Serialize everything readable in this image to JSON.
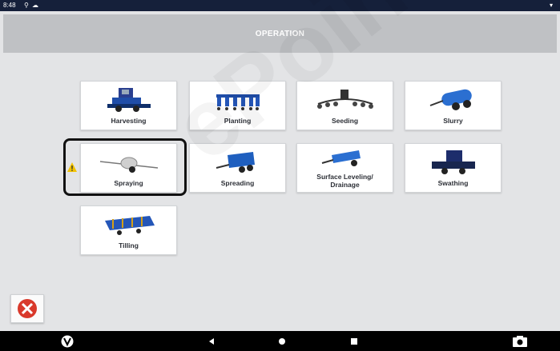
{
  "statusbar": {
    "time": "8:48"
  },
  "header": {
    "title": "OPERATION"
  },
  "operations": [
    {
      "id": "harvesting",
      "label": "Harvesting"
    },
    {
      "id": "planting",
      "label": "Planting"
    },
    {
      "id": "seeding",
      "label": "Seeding"
    },
    {
      "id": "slurry",
      "label": "Slurry"
    },
    {
      "id": "spraying",
      "label": "Spraying"
    },
    {
      "id": "spreading",
      "label": "Spreading"
    },
    {
      "id": "surface-leveling",
      "label": "Surface Leveling/\nDrainage"
    },
    {
      "id": "swathing",
      "label": "Swathing"
    },
    {
      "id": "tilling",
      "label": "Tilling"
    }
  ],
  "footer": {
    "close_icon": "close-icon"
  },
  "navbar": {
    "icons": [
      "app-logo-icon",
      "back-icon",
      "home-icon",
      "recents-icon",
      "screenshot-icon"
    ]
  },
  "colors": {
    "statusbar": "#15203a",
    "accent_blue": "#1f5fbf",
    "close_red": "#d9392b"
  },
  "watermark": "ePoint"
}
